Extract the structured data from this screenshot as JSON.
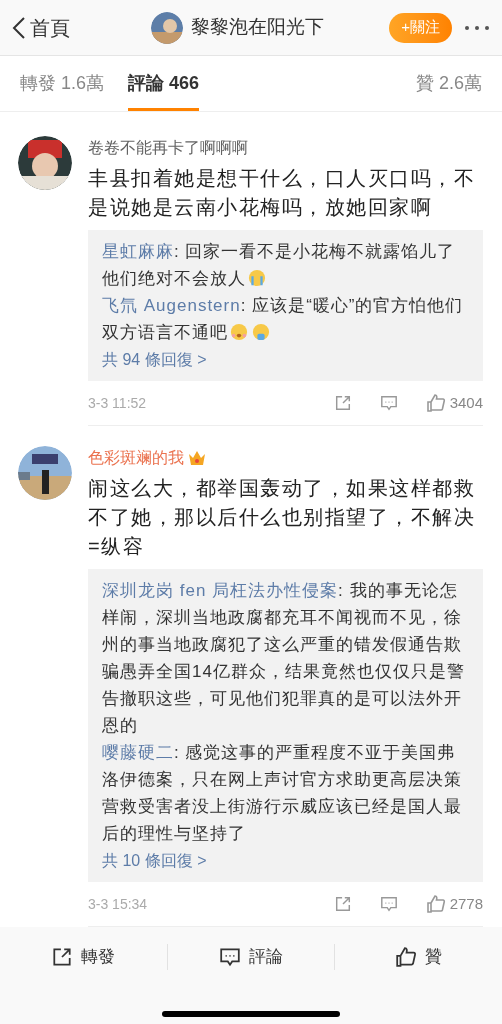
{
  "header": {
    "back_label": "首頁",
    "username": "黎黎泡在阳光下",
    "follow_label": "+關注"
  },
  "tabs": [
    {
      "label": "轉發 1.6萬",
      "selected": false
    },
    {
      "label": "評論 466",
      "selected": true
    },
    {
      "label": "贊 2.6萬",
      "selected": false
    }
  ],
  "comments": [
    {
      "author": "卷卷不能再卡了啊啊啊",
      "vip": false,
      "text": "丰县扣着她是想干什么，口人灭口吗，不是说她是云南小花梅吗，放她回家啊",
      "replies": [
        {
          "author": "星虹麻麻",
          "text": ": 回家一看不是小花梅不就露馅儿了他们绝对不会放人",
          "emojis": [
            {
              "kind": "crying"
            }
          ]
        },
        {
          "author": "飞氘 Augenstern",
          "text": ": 应该是“暖心”的官方怕他们双方语言不通吧",
          "emojis": [
            {
              "kind": "scared"
            },
            {
              "kind": "sobbing"
            }
          ]
        }
      ],
      "more_replies": "共 94 條回復 >",
      "time": "3-3 11:52",
      "likes": "3404"
    },
    {
      "author": "色彩斑斓的我",
      "vip": true,
      "text": "闹这么大，都举国轰动了，如果这样都救不了她，那以后什么也别指望了，不解决=纵容",
      "replies": [
        {
          "author": "深圳龙岗 fen 局枉法办性侵案",
          "text": ": 我的事无论怎样闹，深圳当地政腐都充耳不闻视而不见，徐州的事当地政腐犯了这么严重的错发假通告欺骗愚弄全国14亿群众，结果竟然也仅仅只是警告撤职这些，可见他们犯罪真的是可以法外开恩的"
        },
        {
          "author": "嘤藤硬二",
          "text": ": 感觉这事的严重程度不亚于美国弗洛伊德案，只在网上声讨官方求助更高层决策营救受害者没上街游行示威应该已经是国人最后的理性与坚持了"
        }
      ],
      "more_replies": "共 10 條回復 >",
      "time": "3-3 15:34",
      "likes": "2778"
    }
  ],
  "bottom_bar": [
    {
      "kind": "repost",
      "label": "轉發"
    },
    {
      "kind": "comment",
      "label": "評論"
    },
    {
      "kind": "like",
      "label": "贊"
    }
  ]
}
